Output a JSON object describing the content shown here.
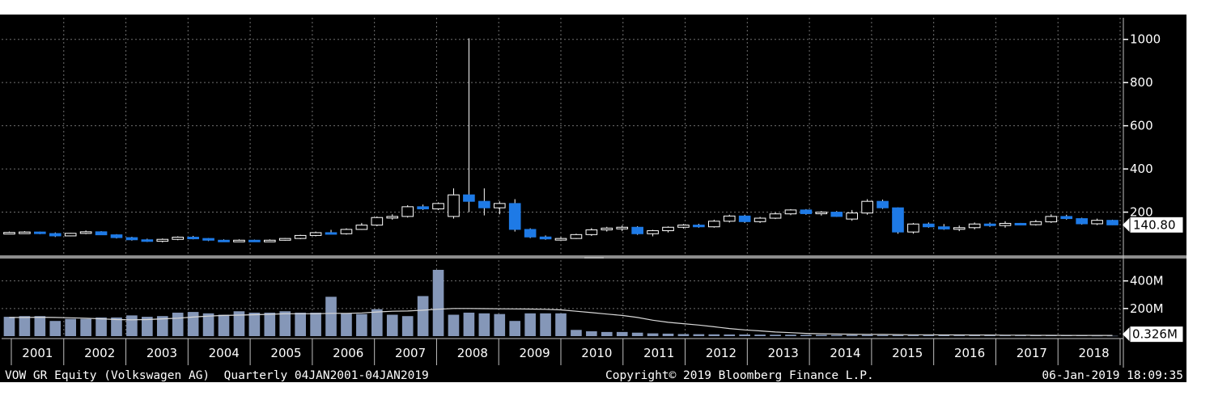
{
  "chart_data": [
    {
      "type": "candlestick",
      "title": "",
      "x_range": [
        "2001",
        "2018"
      ],
      "ylim": [
        0,
        1100
      ],
      "yticks": [
        200,
        400,
        600,
        800,
        1000
      ],
      "last_price_label": "140.80",
      "colors": {
        "up": "#ffffff",
        "down": "#1e7ae6",
        "background": "#000000",
        "grid": "#707070"
      },
      "candles": [
        {
          "open": 105,
          "high": 110,
          "low": 100,
          "close": 106
        },
        {
          "open": 106,
          "high": 112,
          "low": 102,
          "close": 108
        },
        {
          "open": 108,
          "high": 110,
          "low": 98,
          "close": 101
        },
        {
          "open": 101,
          "high": 106,
          "low": 85,
          "close": 90
        },
        {
          "open": 90,
          "high": 104,
          "low": 88,
          "close": 102
        },
        {
          "open": 102,
          "high": 115,
          "low": 98,
          "close": 109
        },
        {
          "open": 109,
          "high": 112,
          "low": 94,
          "close": 95
        },
        {
          "open": 95,
          "high": 98,
          "low": 78,
          "close": 82
        },
        {
          "open": 82,
          "high": 86,
          "low": 68,
          "close": 72
        },
        {
          "open": 72,
          "high": 77,
          "low": 62,
          "close": 65
        },
        {
          "open": 65,
          "high": 78,
          "low": 60,
          "close": 74
        },
        {
          "open": 74,
          "high": 88,
          "low": 70,
          "close": 84
        },
        {
          "open": 84,
          "high": 90,
          "low": 74,
          "close": 78
        },
        {
          "open": 78,
          "high": 80,
          "low": 66,
          "close": 70
        },
        {
          "open": 70,
          "high": 74,
          "low": 62,
          "close": 68
        },
        {
          "open": 68,
          "high": 74,
          "low": 64,
          "close": 70
        },
        {
          "open": 70,
          "high": 73,
          "low": 66,
          "close": 69
        },
        {
          "open": 69,
          "high": 74,
          "low": 65,
          "close": 70
        },
        {
          "open": 70,
          "high": 80,
          "low": 68,
          "close": 78
        },
        {
          "open": 78,
          "high": 95,
          "low": 75,
          "close": 92
        },
        {
          "open": 92,
          "high": 110,
          "low": 88,
          "close": 105
        },
        {
          "open": 105,
          "high": 118,
          "low": 98,
          "close": 100
        },
        {
          "open": 100,
          "high": 125,
          "low": 96,
          "close": 120
        },
        {
          "open": 120,
          "high": 150,
          "low": 118,
          "close": 140
        },
        {
          "open": 140,
          "high": 180,
          "low": 135,
          "close": 175
        },
        {
          "open": 175,
          "high": 190,
          "low": 165,
          "close": 180
        },
        {
          "open": 180,
          "high": 232,
          "low": 175,
          "close": 225
        },
        {
          "open": 225,
          "high": 235,
          "low": 210,
          "close": 215
        },
        {
          "open": 215,
          "high": 245,
          "low": 210,
          "close": 240
        },
        {
          "open": 180,
          "high": 310,
          "low": 170,
          "close": 280
        },
        {
          "open": 280,
          "high": 1005,
          "low": 200,
          "close": 250
        },
        {
          "open": 250,
          "high": 310,
          "low": 185,
          "close": 220
        },
        {
          "open": 220,
          "high": 250,
          "low": 190,
          "close": 240
        },
        {
          "open": 240,
          "high": 260,
          "low": 110,
          "close": 120
        },
        {
          "open": 120,
          "high": 125,
          "low": 80,
          "close": 85
        },
        {
          "open": 85,
          "high": 92,
          "low": 72,
          "close": 76
        },
        {
          "open": 76,
          "high": 84,
          "low": 72,
          "close": 78
        },
        {
          "open": 78,
          "high": 100,
          "low": 76,
          "close": 96
        },
        {
          "open": 96,
          "high": 126,
          "low": 90,
          "close": 118
        },
        {
          "open": 118,
          "high": 132,
          "low": 110,
          "close": 126
        },
        {
          "open": 126,
          "high": 138,
          "low": 112,
          "close": 130
        },
        {
          "open": 130,
          "high": 135,
          "low": 95,
          "close": 100
        },
        {
          "open": 100,
          "high": 118,
          "low": 88,
          "close": 114
        },
        {
          "open": 114,
          "high": 134,
          "low": 106,
          "close": 130
        },
        {
          "open": 130,
          "high": 145,
          "low": 124,
          "close": 140
        },
        {
          "open": 140,
          "high": 146,
          "low": 128,
          "close": 132
        },
        {
          "open": 132,
          "high": 165,
          "low": 128,
          "close": 158
        },
        {
          "open": 158,
          "high": 188,
          "low": 152,
          "close": 182
        },
        {
          "open": 182,
          "high": 188,
          "low": 150,
          "close": 156
        },
        {
          "open": 156,
          "high": 178,
          "low": 150,
          "close": 172
        },
        {
          "open": 172,
          "high": 198,
          "low": 168,
          "close": 192
        },
        {
          "open": 192,
          "high": 214,
          "low": 186,
          "close": 210
        },
        {
          "open": 210,
          "high": 214,
          "low": 188,
          "close": 193
        },
        {
          "open": 193,
          "high": 205,
          "low": 184,
          "close": 200
        },
        {
          "open": 200,
          "high": 205,
          "low": 178,
          "close": 180
        },
        {
          "open": 168,
          "high": 210,
          "low": 160,
          "close": 196
        },
        {
          "open": 196,
          "high": 260,
          "low": 188,
          "close": 250
        },
        {
          "open": 250,
          "high": 258,
          "low": 215,
          "close": 220
        },
        {
          "open": 220,
          "high": 222,
          "low": 100,
          "close": 108
        },
        {
          "open": 108,
          "high": 150,
          "low": 100,
          "close": 145
        },
        {
          "open": 145,
          "high": 152,
          "low": 128,
          "close": 132
        },
        {
          "open": 132,
          "high": 145,
          "low": 118,
          "close": 122
        },
        {
          "open": 122,
          "high": 138,
          "low": 112,
          "close": 128
        },
        {
          "open": 128,
          "high": 152,
          "low": 120,
          "close": 145
        },
        {
          "open": 145,
          "high": 152,
          "low": 132,
          "close": 138
        },
        {
          "open": 138,
          "high": 158,
          "low": 128,
          "close": 148
        },
        {
          "open": 148,
          "high": 150,
          "low": 140,
          "close": 142
        },
        {
          "open": 142,
          "high": 164,
          "low": 138,
          "close": 156
        },
        {
          "open": 155,
          "high": 190,
          "low": 150,
          "close": 180
        },
        {
          "open": 180,
          "high": 188,
          "low": 165,
          "close": 170
        },
        {
          "open": 170,
          "high": 174,
          "low": 142,
          "close": 146
        },
        {
          "open": 146,
          "high": 170,
          "low": 140,
          "close": 162
        },
        {
          "open": 162,
          "high": 165,
          "low": 140,
          "close": 141
        }
      ]
    },
    {
      "type": "bar",
      "title": "",
      "ylim": [
        0,
        550
      ],
      "yticks": [
        200,
        400
      ],
      "ytick_labels": [
        "200M",
        "400M"
      ],
      "last_value_label": "0.326M",
      "colors": {
        "bar": "#8597b8",
        "line": "#d9d9d9"
      },
      "values": [
        140,
        145,
        145,
        110,
        125,
        125,
        135,
        135,
        150,
        140,
        145,
        170,
        175,
        165,
        155,
        180,
        170,
        170,
        180,
        170,
        170,
        285,
        165,
        160,
        195,
        155,
        145,
        290,
        480,
        155,
        170,
        165,
        160,
        110,
        165,
        165,
        165,
        45,
        35,
        30,
        30,
        25,
        20,
        18,
        15,
        14,
        13,
        12,
        12,
        11,
        10,
        10,
        9,
        9,
        8,
        8,
        8,
        7,
        7,
        6,
        6,
        6,
        5,
        5,
        5,
        4,
        4,
        4,
        3,
        3,
        3,
        2,
        2
      ],
      "moving_average": [
        135,
        135,
        137,
        135,
        133,
        130,
        125,
        120,
        118,
        120,
        125,
        130,
        138,
        145,
        150,
        152,
        155,
        158,
        162,
        162,
        162,
        165,
        165,
        168,
        175,
        180,
        182,
        188,
        195,
        200,
        200,
        199,
        198,
        197,
        196,
        194,
        190,
        180,
        170,
        160,
        150,
        135,
        115,
        100,
        90,
        80,
        68,
        55,
        45,
        38,
        30,
        25,
        20,
        17,
        15,
        14,
        13,
        12,
        11,
        10,
        10,
        9,
        9,
        8,
        8,
        7,
        7,
        6,
        6,
        5,
        5,
        5,
        5
      ]
    }
  ],
  "x_axis": {
    "years": [
      "2001",
      "2002",
      "2003",
      "2004",
      "2005",
      "2006",
      "2007",
      "2008",
      "2009",
      "2010",
      "2011",
      "2012",
      "2013",
      "2014",
      "2015",
      "2016",
      "2017",
      "2018"
    ]
  },
  "footer": {
    "security": "VOW GR Equity (Volkswagen AG)  Quarterly 04JAN2001-04JAN2019",
    "copyright": "Copyright© 2019 Bloomberg Finance L.P.",
    "timestamp": "06-Jan-2019 18:09:35"
  }
}
